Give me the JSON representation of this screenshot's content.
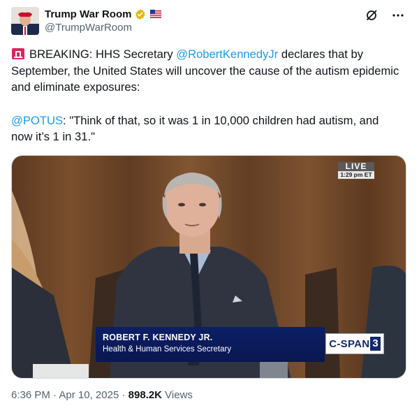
{
  "author": {
    "display_name": "Trump War Room",
    "handle": "@TrumpWarRoom",
    "verified_icon": "gold-verified-badge-icon",
    "flag_icon": "american-flag-icon"
  },
  "actions": {
    "grok_icon": "grok-icon",
    "more_icon": "more-dots-icon",
    "more_label": "..."
  },
  "tweet": {
    "line1_prefix": "BREAKING: HHS Secretary ",
    "mention1": "@RobertKennedyJr",
    "line1_suffix": " declares that by September, the United States will uncover the cause of the autism epidemic and eliminate exposures:",
    "mention2": "@POTUS",
    "quote": ": \"Think of that, so it was 1 in 10,000 children had autism, and now it’s 1 in 31.\"",
    "siren_icon": "police-siren-emoji-icon"
  },
  "media": {
    "live_label": "LIVE",
    "live_time": "1:29 pm ET",
    "chyron_name": "ROBERT F. KENNEDY JR.",
    "chyron_title": "Health & Human Services Secretary",
    "network_text": "C-SPAN",
    "network_number": "3"
  },
  "meta": {
    "time": "6:36 PM",
    "separator": " · ",
    "date": "Apr 10, 2025",
    "views_count": "898.2K",
    "views_label": " Views"
  },
  "colors": {
    "link": "#1d9bf0",
    "secondary_text": "#536471",
    "chyron_blue": "#0c1f66",
    "verified_gold": "#e2b719"
  }
}
